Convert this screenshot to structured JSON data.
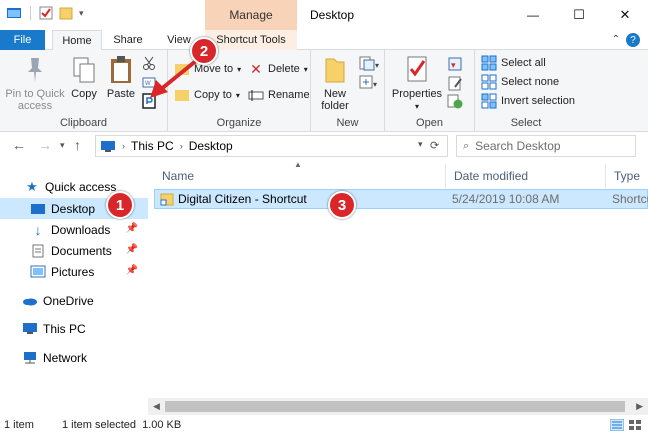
{
  "window": {
    "title": "Desktop",
    "context_tab": "Manage",
    "minimize": "—",
    "maximize": "☐",
    "close": "✕"
  },
  "tabs": {
    "file": "File",
    "home": "Home",
    "share": "Share",
    "view": "View",
    "shortcut_tools": "Shortcut Tools",
    "help": "?"
  },
  "ribbon": {
    "clipboard": {
      "label": "Clipboard",
      "pin_line1": "Pin to Quick",
      "pin_line2": "access",
      "copy": "Copy",
      "paste": "Paste"
    },
    "organize": {
      "label": "Organize",
      "move_to": "Move to",
      "copy_to": "Copy to",
      "delete": "Delete",
      "rename": "Rename"
    },
    "new": {
      "label": "New",
      "new_folder_line1": "New",
      "new_folder_line2": "folder"
    },
    "open": {
      "label": "Open",
      "properties": "Properties"
    },
    "select": {
      "label": "Select",
      "select_all": "Select all",
      "select_none": "Select none",
      "invert": "Invert selection"
    }
  },
  "address": {
    "crumb1": "This PC",
    "crumb2": "Desktop",
    "search_placeholder": "Search Desktop"
  },
  "navpane": {
    "quick_access": "Quick access",
    "desktop": "Desktop",
    "downloads": "Downloads",
    "documents": "Documents",
    "pictures": "Pictures",
    "onedrive": "OneDrive",
    "this_pc": "This PC",
    "network": "Network"
  },
  "columns": {
    "name": "Name",
    "date": "Date modified",
    "type": "Type"
  },
  "files": [
    {
      "name": "Digital Citizen - Shortcut",
      "date": "5/24/2019 10:08 AM",
      "type": "Shortcut"
    }
  ],
  "status": {
    "count": "1 item",
    "selected": "1 item selected  1.00 KB"
  },
  "callouts": [
    "1",
    "2",
    "3"
  ],
  "colors": {
    "accent": "#1979ca",
    "manage_tab": "#f8d3b8",
    "selection": "#cce8ff",
    "callout": "#d8262b"
  }
}
